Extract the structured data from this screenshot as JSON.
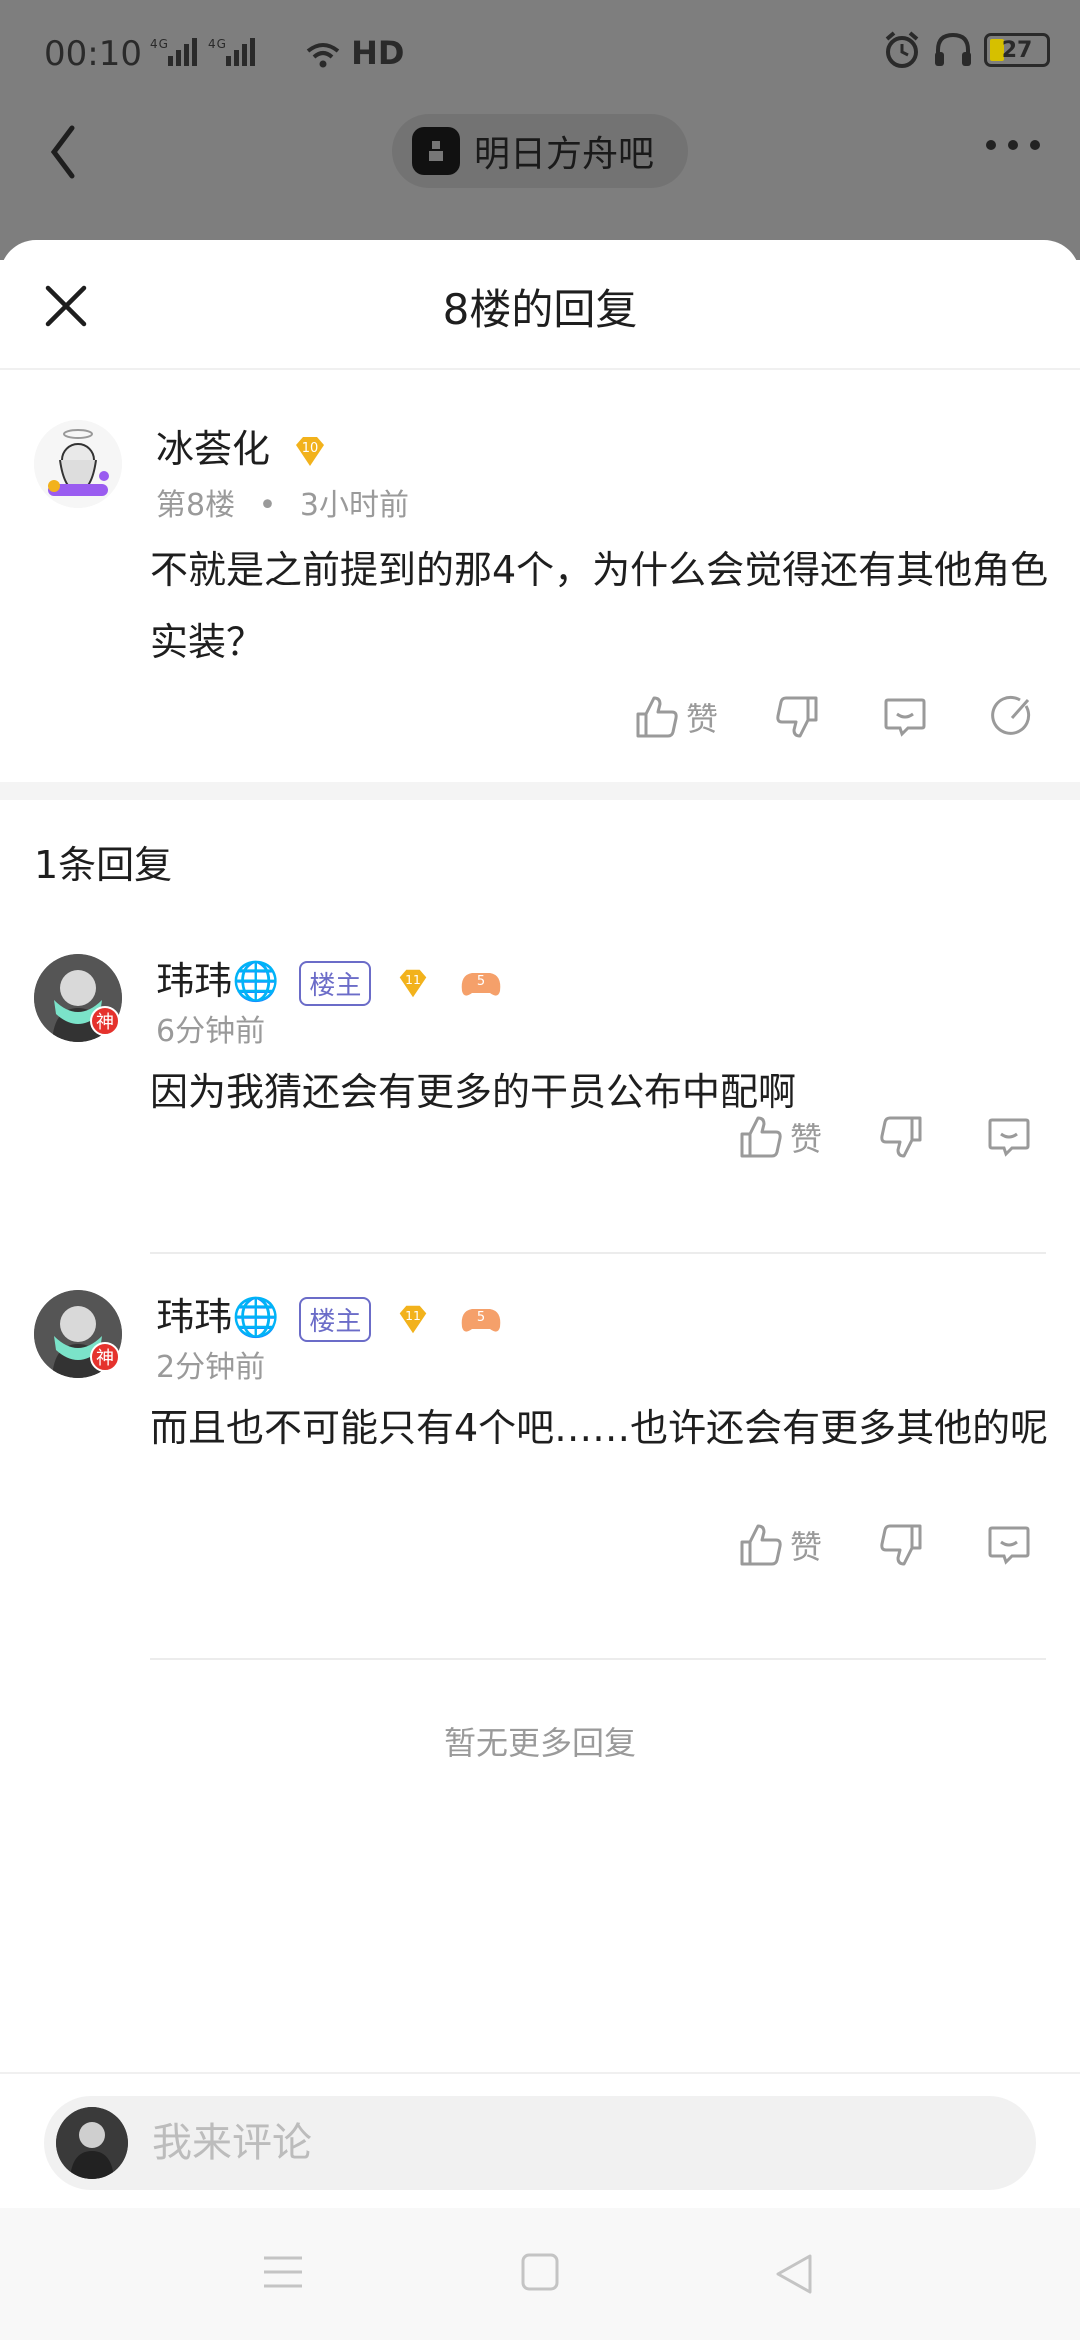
{
  "status_bar": {
    "time": "00:10",
    "network": "4G 4G",
    "wifi": "HD",
    "battery": "27"
  },
  "nav": {
    "forum_name": "明日方舟吧"
  },
  "sheet": {
    "title": "8楼的回复"
  },
  "main_comment": {
    "username": "冰荟化",
    "level": "10",
    "floor": "第8楼",
    "dot": "•",
    "time": "3小时前",
    "text": "不就是之前提到的那4个，为什么会觉得还有其他角色实装？",
    "like_label": "赞"
  },
  "replies_count": "1条回复",
  "replies": [
    {
      "username": "玮玮🌐",
      "badge": "楼主",
      "level": "11",
      "fan": "5",
      "avatar_badge": "神",
      "time": "6分钟前",
      "text": "因为我猜还会有更多的干员公布中配啊",
      "like_label": "赞"
    },
    {
      "username": "玮玮🌐",
      "badge": "楼主",
      "level": "11",
      "fan": "5",
      "avatar_badge": "神",
      "time": "2分钟前",
      "text": "而且也不可能只有4个吧……也许还会有更多其他的呢",
      "like_label": "赞"
    }
  ],
  "no_more": "暂无更多回复",
  "comment_input": {
    "placeholder": "我来评论"
  },
  "colors": {
    "accent_badge": "#6b6cc8",
    "level_gold": "#f2b21c",
    "avatar_badge_red": "#e5322d"
  }
}
